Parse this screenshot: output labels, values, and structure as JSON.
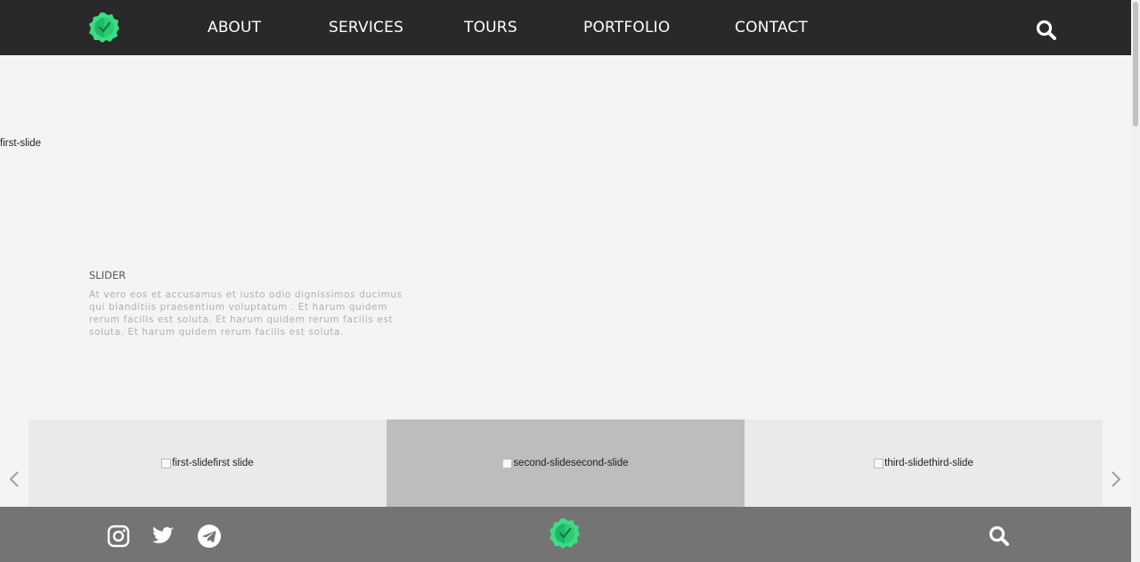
{
  "header": {
    "logo_icon": "green-badge-check-icon",
    "nav": [
      {
        "label": "ABOUT"
      },
      {
        "label": "SERVICES"
      },
      {
        "label": "TOURS"
      },
      {
        "label": "PORTFOLIO"
      },
      {
        "label": "CONTACT"
      }
    ],
    "search_icon": "search-icon"
  },
  "hero": {
    "image_alt": "first-slide",
    "slider_title": "SLIDER",
    "slider_text": "At vero eos et accusamus et iusto odio dignissimos ducimus qui blanditiis praesentium voluptatum . Et harum quidem rerum facilis est soluta. Et harum quidem rerum facilis est soluta. Et harum quidem rerum facilis est soluta."
  },
  "thumbnails": [
    {
      "alt": "first-slide",
      "caption": "first slide",
      "active": false
    },
    {
      "alt": "second-slide",
      "caption": "second-slide",
      "active": true
    },
    {
      "alt": "third-slide",
      "caption": "third-slide",
      "active": false
    }
  ],
  "controls": {
    "prev_icon": "chevron-left-icon",
    "next_icon": "chevron-right-icon"
  },
  "footer": {
    "social": [
      "instagram-icon",
      "twitter-icon",
      "telegram-icon"
    ],
    "logo_icon": "green-badge-check-icon",
    "search_icon": "search-icon"
  },
  "colors": {
    "header_bg": "#292929",
    "footer_bg": "#747474",
    "page_bg": "#f4f4f4",
    "thumb_bg": "#eaeaea",
    "thumb_active_bg": "#bdbdbd",
    "logo_green": "#3ddc84"
  }
}
